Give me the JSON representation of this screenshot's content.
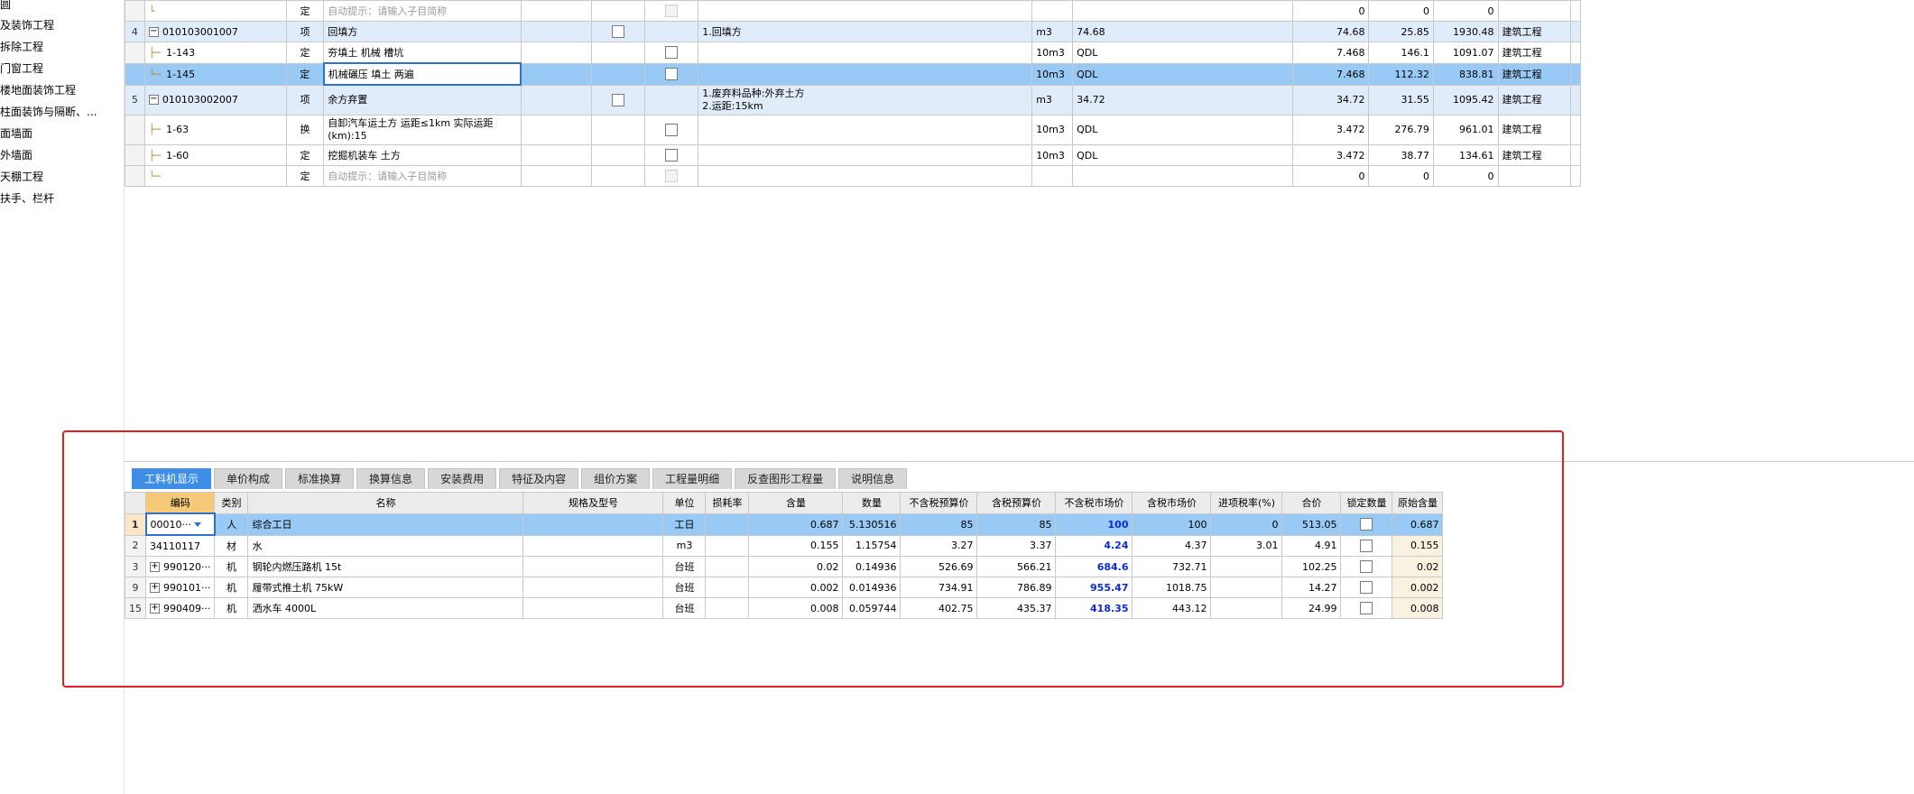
{
  "sidebar": {
    "items": [
      "圆",
      "及装饰工程",
      "拆除工程",
      "门窗工程",
      "楼地面装饰工程",
      "柱面装饰与隔断、...",
      "面墙面",
      "外墙面",
      "天棚工程",
      "扶手、栏杆"
    ]
  },
  "upper": {
    "rows": [
      {
        "no": "",
        "code": "",
        "cat": "定",
        "name": "自动提示：请输入子目简称",
        "feature": "",
        "unit": "",
        "expr": "",
        "qty": "0",
        "price": "0",
        "total": "0",
        "major": ""
      },
      {
        "no": "4",
        "code": "010103001007",
        "cat": "项",
        "name": "回填方",
        "feature": "1.回填方",
        "unit": "m3",
        "expr": "74.68",
        "qty": "74.68",
        "price": "25.85",
        "total": "1930.48",
        "major": "建筑工程"
      },
      {
        "no": "",
        "code": "1-143",
        "cat": "定",
        "name": "夯填土 机械 槽坑",
        "feature": "",
        "unit": "10m3",
        "expr": "QDL",
        "qty": "7.468",
        "price": "146.1",
        "total": "1091.07",
        "major": "建筑工程"
      },
      {
        "no": "",
        "code": "1-145",
        "cat": "定",
        "name": "机械碾压 填土 两遍",
        "feature": "",
        "unit": "10m3",
        "expr": "QDL",
        "qty": "7.468",
        "price": "112.32",
        "total": "838.81",
        "major": "建筑工程"
      },
      {
        "no": "5",
        "code": "010103002007",
        "cat": "项",
        "name": "余方弃置",
        "feature": "1.废弃料品种:外弃土方\n2.运距:15km",
        "unit": "m3",
        "expr": "34.72",
        "qty": "34.72",
        "price": "31.55",
        "total": "1095.42",
        "major": "建筑工程"
      },
      {
        "no": "",
        "code": "1-63",
        "cat": "换",
        "name": "自卸汽车运土方 运距≤1km  实际运距(km):15",
        "feature": "",
        "unit": "10m3",
        "expr": "QDL",
        "qty": "3.472",
        "price": "276.79",
        "total": "961.01",
        "major": "建筑工程"
      },
      {
        "no": "",
        "code": "1-60",
        "cat": "定",
        "name": "挖掘机装车 土方",
        "feature": "",
        "unit": "10m3",
        "expr": "QDL",
        "qty": "3.472",
        "price": "38.77",
        "total": "134.61",
        "major": "建筑工程"
      },
      {
        "no": "",
        "code": "",
        "cat": "定",
        "name": "自动提示：请输入子目简称",
        "feature": "",
        "unit": "",
        "expr": "",
        "qty": "0",
        "price": "0",
        "total": "0",
        "major": ""
      }
    ]
  },
  "tabs": [
    "工料机显示",
    "单价构成",
    "标准换算",
    "换算信息",
    "安装费用",
    "特征及内容",
    "组价方案",
    "工程量明细",
    "反查图形工程量",
    "说明信息"
  ],
  "lower": {
    "headers": [
      "",
      "编码",
      "类别",
      "名称",
      "规格及型号",
      "单位",
      "损耗率",
      "含量",
      "数量",
      "不含税预算价",
      "含税预算价",
      "不含税市场价",
      "含税市场价",
      "进项税率(%)",
      "合价",
      "锁定数量",
      "原始含量"
    ],
    "rows": [
      {
        "no": "1",
        "code": "00010···",
        "cat": "人",
        "name": "综合工日",
        "spec": "",
        "unit": "工日",
        "loss": "",
        "content": "0.687",
        "qty": "5.130516",
        "bp": "85",
        "bpt": "85",
        "mp": "100",
        "mpt": "100",
        "tax": "0",
        "total": "513.05",
        "orig": "0.687"
      },
      {
        "no": "2",
        "code": "34110117",
        "cat": "材",
        "name": "水",
        "spec": "",
        "unit": "m3",
        "loss": "",
        "content": "0.155",
        "qty": "1.15754",
        "bp": "3.27",
        "bpt": "3.37",
        "mp": "4.24",
        "mpt": "4.37",
        "tax": "3.01",
        "total": "4.91",
        "orig": "0.155"
      },
      {
        "no": "3",
        "code": "990120···",
        "cat": "机",
        "name": "钢轮内燃压路机 15t",
        "spec": "",
        "unit": "台班",
        "loss": "",
        "content": "0.02",
        "qty": "0.14936",
        "bp": "526.69",
        "bpt": "566.21",
        "mp": "684.6",
        "mpt": "732.71",
        "tax": "",
        "total": "102.25",
        "orig": "0.02"
      },
      {
        "no": "9",
        "code": "990101···",
        "cat": "机",
        "name": "履带式推土机 75kW",
        "spec": "",
        "unit": "台班",
        "loss": "",
        "content": "0.002",
        "qty": "0.014936",
        "bp": "734.91",
        "bpt": "786.89",
        "mp": "955.47",
        "mpt": "1018.75",
        "tax": "",
        "total": "14.27",
        "orig": "0.002"
      },
      {
        "no": "15",
        "code": "990409···",
        "cat": "机",
        "name": "洒水车 4000L",
        "spec": "",
        "unit": "台班",
        "loss": "",
        "content": "0.008",
        "qty": "0.059744",
        "bp": "402.75",
        "bpt": "435.37",
        "mp": "418.35",
        "mpt": "443.12",
        "tax": "",
        "total": "24.99",
        "orig": "0.008"
      }
    ]
  }
}
